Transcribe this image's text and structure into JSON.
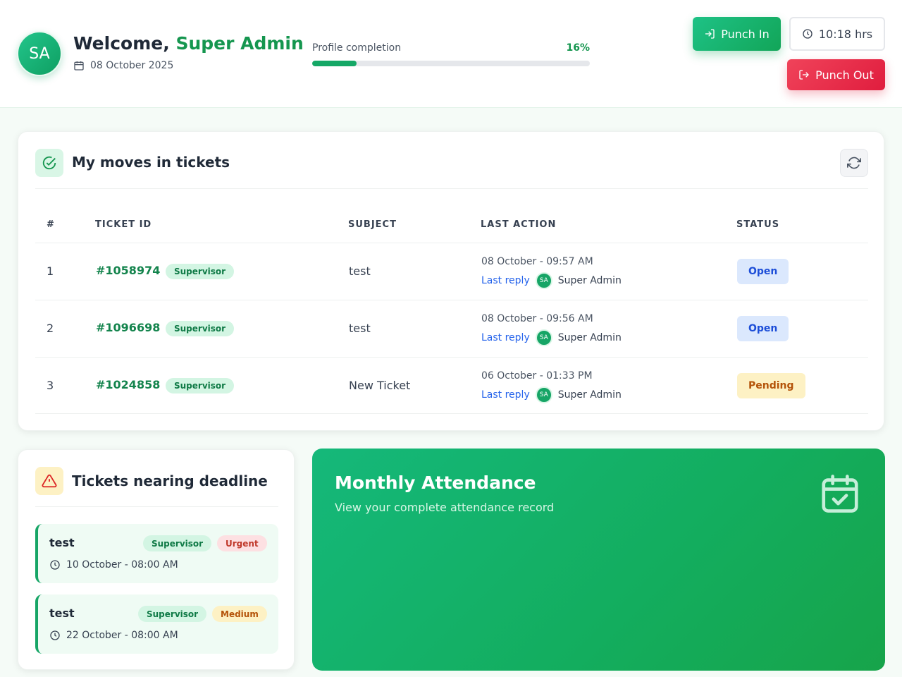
{
  "header": {
    "avatar_initials": "SA",
    "welcome_prefix": "Welcome,",
    "user_name": "Super Admin",
    "date": "08 October 2025",
    "profile_label": "Profile completion",
    "profile_percent_label": "16%",
    "profile_percent": 16,
    "punch_in_label": "Punch In",
    "hours_label": "10:18 hrs",
    "punch_out_label": "Punch Out"
  },
  "moves": {
    "title": "My moves in tickets",
    "columns": {
      "num": "#",
      "ticket_id": "TICKET ID",
      "subject": "SUBJECT",
      "last_action": "LAST ACTION",
      "status": "STATUS"
    },
    "rows": [
      {
        "num": "1",
        "id": "#1058974",
        "role": "Supervisor",
        "subject": "test",
        "time": "08 October - 09:57 AM",
        "reply_label": "Last reply",
        "reply_initials": "SA",
        "reply_name": "Super Admin",
        "status": "Open"
      },
      {
        "num": "2",
        "id": "#1096698",
        "role": "Supervisor",
        "subject": "test",
        "time": "08 October - 09:56 AM",
        "reply_label": "Last reply",
        "reply_initials": "SA",
        "reply_name": "Super Admin",
        "status": "Open"
      },
      {
        "num": "3",
        "id": "#1024858",
        "role": "Supervisor",
        "subject": "New Ticket",
        "time": "06 October - 01:33 PM",
        "reply_label": "Last reply",
        "reply_initials": "SA",
        "reply_name": "Super Admin",
        "status": "Pending"
      }
    ]
  },
  "deadline": {
    "title": "Tickets nearing deadline",
    "items": [
      {
        "name": "test",
        "role": "Supervisor",
        "priority": "Urgent",
        "time": "10 October - 08:00 AM"
      },
      {
        "name": "test",
        "role": "Supervisor",
        "priority": "Medium",
        "time": "22 October - 08:00 AM"
      }
    ]
  },
  "attendance": {
    "title": "Monthly Attendance",
    "subtitle": "View your complete attendance record"
  },
  "colors": {
    "brand_green": "#15964f",
    "danger_red": "#e01d3e",
    "open_blue": "#1d4ed8",
    "pending_amber": "#b45309"
  },
  "icons": [
    "calendar-icon",
    "login-icon",
    "clock-icon",
    "logout-icon",
    "check-circle-icon",
    "refresh-icon",
    "warning-icon",
    "calendar-check-icon"
  ]
}
